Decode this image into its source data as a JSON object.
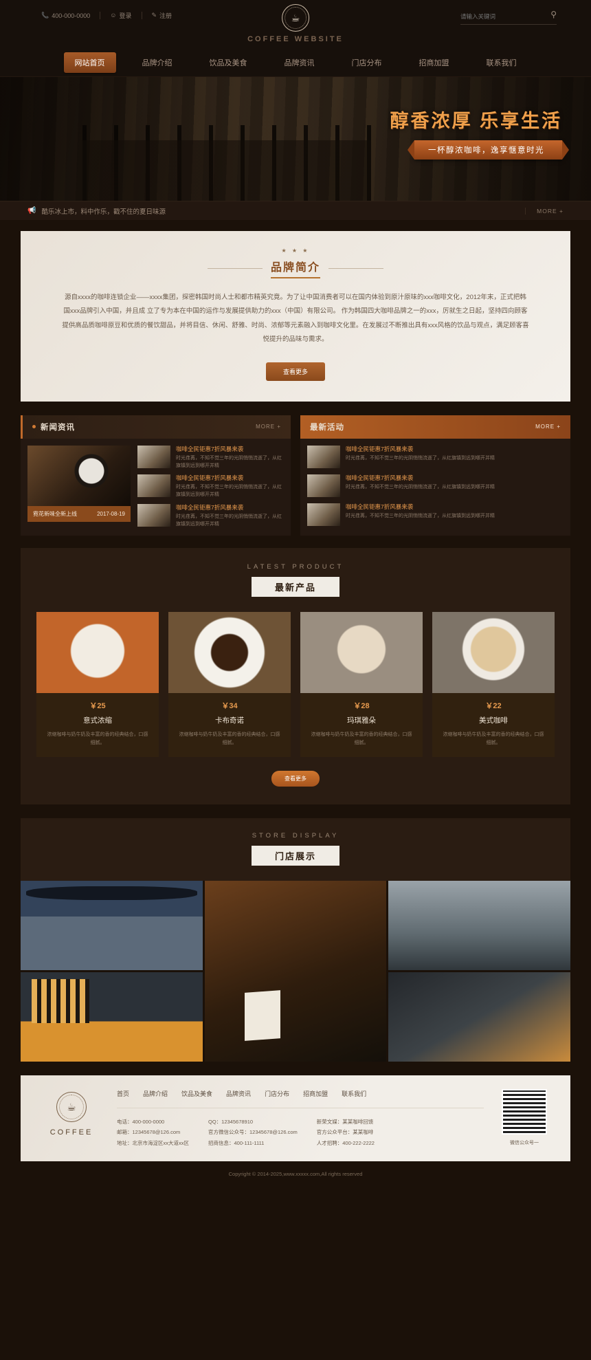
{
  "topbar": {
    "phone_icon": "phone-icon",
    "phone": "400-000-0000",
    "login_icon": "user-icon",
    "login": "登录",
    "register_icon": "edit-icon",
    "register": "注册",
    "search_placeholder": "请输入关键词",
    "search_value": "",
    "search_icon": "search-icon"
  },
  "logo": {
    "cup_icon": "coffee-cup-icon",
    "badge_text": "COFFEE TIME",
    "site_name": "COFFEE WEBSITE"
  },
  "nav": {
    "items": [
      {
        "label": "网站首页",
        "active": true
      },
      {
        "label": "品牌介绍",
        "active": false
      },
      {
        "label": "饮品及美食",
        "active": false
      },
      {
        "label": "品牌资讯",
        "active": false
      },
      {
        "label": "门店分布",
        "active": false
      },
      {
        "label": "招商加盟",
        "active": false
      },
      {
        "label": "联系我们",
        "active": false
      }
    ]
  },
  "banner": {
    "title": "醇香浓厚 乐享生活",
    "ribbon": "一杯醇浓咖啡，逸享惬意时光"
  },
  "ticker": {
    "icon": "megaphone-icon",
    "text": "酷乐冰上市，料中作乐，戳不住的夏日味源",
    "more": "MORE +"
  },
  "brand": {
    "stars": "★ ★ ★",
    "title": "品牌简介",
    "paragraph": "源自xxxx的咖啡连锁企业——xxxx集团，探密韩国时尚人士和都市精英究竟。为了让中国消费者可以在国内体验到原汁原味的xxx咖啡文化，2012年末，正式把韩国xxx品牌引入中国，并且成 立了专为本在中国的运作与发展提供助力的xxx（中国）有限公司。  作为韩国四大咖啡品牌之一的xxx，厉就生之日起，坚持四向顾客提供高品质咖啡原豆和优质的餐饮甜品，并将目信、休闲、舒雅、时尚、浓郁等元素融入到咖啡文化里。在发展过不断推出具有xxx风格的饮品与观点，满足顾客喜悦提升的品味与需求。",
    "button": "查看更多"
  },
  "news": {
    "title": "新闻资讯",
    "more": "MORE +",
    "feature": {
      "caption": "霓花新味全新上线",
      "date": "2017-08-19"
    },
    "items": [
      {
        "headline": "咖啡全民钜惠7折风暴来袭",
        "body": "时光荏苒，不知不觉三年的光阴悄悄流逝了，从红旗镇到远到哪开并精"
      },
      {
        "headline": "咖啡全民钜惠7折风暴来袭",
        "body": "时光荏苒，不知不觉三年的光阴悄悄流逝了，从红旗镇到远到哪开并精"
      },
      {
        "headline": "咖啡全民钜惠7折风暴来袭",
        "body": "时光荏苒，不知不觉三年的光阴悄悄流逝了，从红旗镇到远到哪开并精"
      }
    ]
  },
  "activity": {
    "title": "最新活动",
    "more": "MORE +",
    "items": [
      {
        "headline": "咖啡全民钜惠7折风暴来袭",
        "body": "时光荏苒，不知不觉三年的光阴悄悄流逝了，从红旗镇到远到哪开并精"
      },
      {
        "headline": "咖啡全民钜惠7折风暴来袭",
        "body": "时光荏苒，不知不觉三年的光阴悄悄流逝了，从红旗镇到远到哪开并精"
      },
      {
        "headline": "咖啡全民钜惠7折风暴来袭",
        "body": "时光荏苒，不知不觉三年的光阴悄悄流逝了，从红旗镇到远到哪开并精"
      }
    ]
  },
  "products": {
    "title_en": "LATEST  PRODUCT",
    "title_cn": "最新产品",
    "more": "查看更多",
    "items": [
      {
        "price": "￥25",
        "name": "意式浓缩",
        "desc": "浓缩咖啡与奶牛奶及丰富的香的经典结合，口感细腻。"
      },
      {
        "price": "￥34",
        "name": "卡布奇诺",
        "desc": "浓缩咖啡与奶牛奶及丰富的香的经典结合，口感细腻。"
      },
      {
        "price": "￥28",
        "name": "玛琪雅朵",
        "desc": "浓缩咖啡与奶牛奶及丰富的香的经典结合，口感细腻。"
      },
      {
        "price": "￥22",
        "name": "美式咖啡",
        "desc": "浓缩咖啡与奶牛奶及丰富的香的经典结合，口感细腻。"
      }
    ]
  },
  "store": {
    "title_en": "STORE  DISPLAY",
    "title_cn": "门店展示"
  },
  "footer": {
    "logo_text": "COFFEE",
    "cup_icon": "coffee-cup-icon",
    "nav": [
      "首页",
      "品牌介绍",
      "饮品及美食",
      "品牌资讯",
      "门店分布",
      "招商加盟",
      "联系我们"
    ],
    "col1": [
      "电话：400-000-0000",
      "邮箱：12345678@126.com",
      "地址：北京市海淀区xx大道xx区"
    ],
    "col2": [
      "QQ：12345678910",
      "官方微信公众号：12345678@126.com",
      "招商信息：400-111-1111"
    ],
    "col3": [
      "新荣文媒：某某咖啡回馈",
      "官方公众平台：某某咖啡",
      "人才招聘：400-222-2222"
    ],
    "qr_caption": "微信公众号一",
    "copyright": "Copyright © 2014-2025,www.xxxxx.com,All rights reserved"
  }
}
